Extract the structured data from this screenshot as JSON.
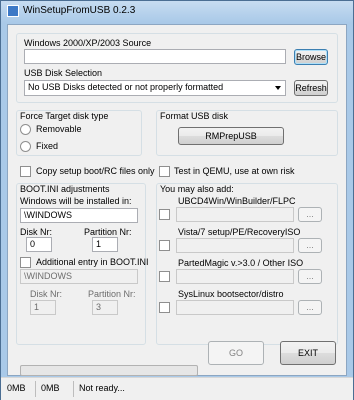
{
  "window": {
    "title": "WinSetupFromUSB 0.2.3"
  },
  "source": {
    "label": "Windows 2000/XP/2003 Source",
    "value": "",
    "browse_label": "Browse"
  },
  "usb": {
    "label": "USB Disk Selection",
    "selected": "No USB Disks detected or not properly formatted",
    "refresh_label": "Refresh"
  },
  "force_type": {
    "title": "Force Target disk type",
    "removable_label": "Removable",
    "fixed_label": "Fixed"
  },
  "format": {
    "title": "Format USB disk",
    "button_label": "RMPrepUSB"
  },
  "options": {
    "copy_boot_label": "Copy setup boot/RC files only",
    "qemu_label": "Test in QEMU, use at own risk"
  },
  "bootini": {
    "title": "BOOT.INI adjustments",
    "install_label": "Windows will be installed in:",
    "install_value": "\\WINDOWS",
    "disk_label": "Disk Nr:",
    "disk_value": "0",
    "partition_label": "Partition Nr:",
    "partition_value": "1",
    "additional_label": "Additional entry in BOOT.INI",
    "additional_value": "\\WINDOWS",
    "disk2_label": "Disk Nr:",
    "disk2_value": "1",
    "partition2_label": "Partition Nr:",
    "partition2_value": "3"
  },
  "also_add": {
    "title": "You may also add:",
    "items": [
      {
        "label": "UBCD4Win/WinBuilder/FLPC",
        "button": "..."
      },
      {
        "label": "Vista/7 setup/PE/RecoveryISO",
        "button": "..."
      },
      {
        "label": "PartedMagic v.>3.0 / Other ISO",
        "button": "..."
      },
      {
        "label": "SysLinux bootsector/distro",
        "button": "..."
      }
    ]
  },
  "actions": {
    "go_label": "GO",
    "exit_label": "EXIT",
    "progress": 0
  },
  "status": {
    "left": "0MB",
    "middle": "0MB",
    "message": "Not ready..."
  }
}
